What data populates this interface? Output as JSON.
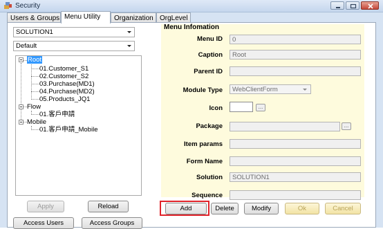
{
  "window": {
    "title": "Security"
  },
  "tabs": [
    {
      "label": "Users & Groups"
    },
    {
      "label": "Menu Utility"
    },
    {
      "label": "Organization"
    },
    {
      "label": "OrgLevel"
    }
  ],
  "left": {
    "solution_select": "SOLUTION1",
    "variant_select": "Default",
    "tree": {
      "root": "Root",
      "root_children": [
        "01.Customer_S1",
        "02.Customer_S2",
        "03.Purchase(MD1)",
        "04.Purchase(MD2)",
        "05.Products_JQ1"
      ],
      "flow": "Flow",
      "flow_children": [
        "01.客戶申請"
      ],
      "mobile": "Mobile",
      "mobile_children": [
        "01.客戶申請_Mobile"
      ]
    },
    "apply_label": "Apply",
    "reload_label": "Reload",
    "access_users_label": "Access Users",
    "access_groups_label": "Access Groups"
  },
  "menu_info": {
    "title": "Menu Infomation",
    "menu_id_label": "Menu ID",
    "menu_id_value": "0",
    "caption_label": "Caption",
    "caption_value": "Root",
    "parent_id_label": "Parent ID",
    "parent_id_value": "",
    "module_type_label": "Module Type",
    "module_type_value": "WebClientForm",
    "icon_label": "Icon",
    "package_label": "Package",
    "package_value": "",
    "item_params_label": "Item params",
    "item_params_value": "",
    "form_name_label": "Form Name",
    "form_name_value": "",
    "solution_label": "Solution",
    "solution_value": "SOLUTION1",
    "sequence_label": "Sequence",
    "sequence_value": "",
    "browse_label": "..."
  },
  "actions": {
    "add_label": "Add",
    "delete_label": "Delete",
    "modify_label": "Modify",
    "ok_label": "Ok",
    "cancel_label": "Cancel"
  },
  "colors": {
    "selection": "#3399ff",
    "panel_bg": "#fefbdd",
    "highlight_box": "#e0232a"
  }
}
